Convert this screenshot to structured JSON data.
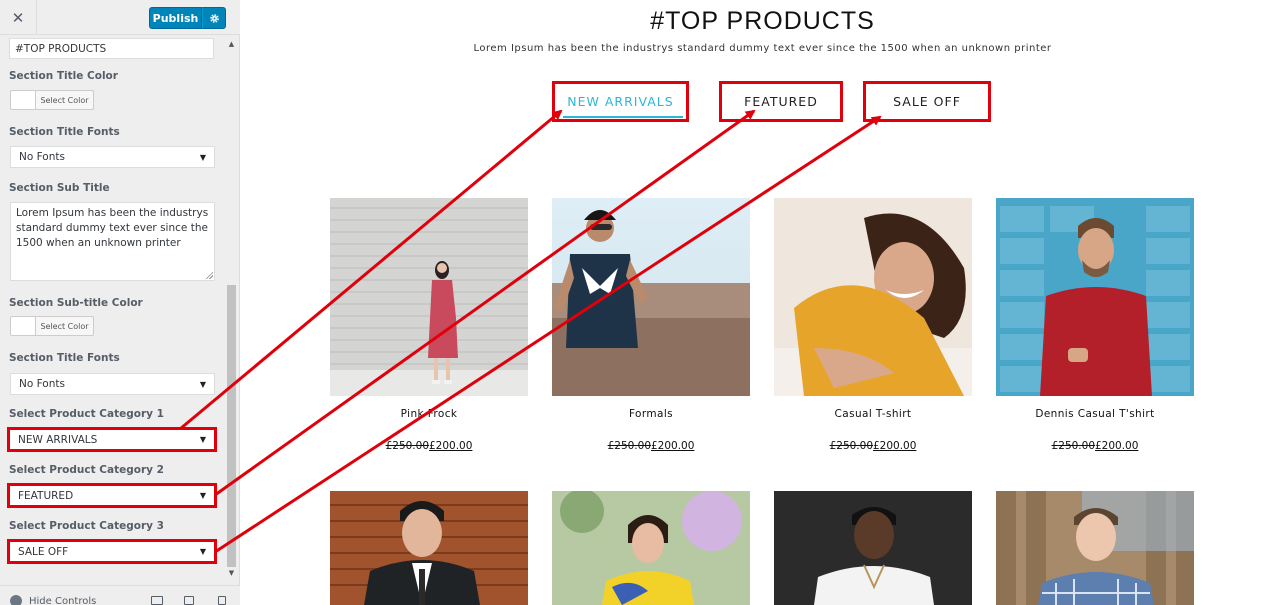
{
  "customizer": {
    "close_label": "✕",
    "publish_label": "Publish",
    "section_title_value": "#TOP PRODUCTS",
    "fields": {
      "title_color_label": "Section Title Color",
      "title_color_button": "Select Color",
      "title_fonts_label": "Section Title Fonts",
      "title_fonts_value": "No Fonts",
      "sub_title_label": "Section Sub Title",
      "sub_title_value": "Lorem Ipsum has been the industrys standard dummy text ever since the 1500 when an unknown printer",
      "sub_title_color_label": "Section Sub-title Color",
      "sub_title_color_button": "Select Color",
      "sub_title_fonts_label": "Section Title Fonts",
      "sub_title_fonts_value": "No Fonts",
      "cat1_label": "Select Product Category 1",
      "cat1_value": "NEW ARRIVALS",
      "cat2_label": "Select Product Category 2",
      "cat2_value": "FEATURED",
      "cat3_label": "Select Product Category 3",
      "cat3_value": "SALE OFF"
    },
    "footer": {
      "hide_controls_label": "Hide Controls"
    }
  },
  "preview": {
    "title": "#TOP PRODUCTS",
    "subtitle": "Lorem Ipsum has been the industrys standard dummy text ever since the 1500 when an unknown printer",
    "tabs": [
      {
        "label": "NEW ARRIVALS",
        "active": true
      },
      {
        "label": "FEATURED",
        "active": false
      },
      {
        "label": "SALE OFF",
        "active": false
      }
    ],
    "products": [
      {
        "name": "Pink Frock",
        "old_price": "£250.00",
        "new_price": "£200.00"
      },
      {
        "name": "Formals",
        "old_price": "£250.00",
        "new_price": "£200.00"
      },
      {
        "name": "Casual T-shirt",
        "old_price": "£250.00",
        "new_price": "£200.00"
      },
      {
        "name": "Dennis Casual T'shirt",
        "old_price": "£250.00",
        "new_price": "£200.00"
      }
    ]
  },
  "colors": {
    "accent": "#0085ba",
    "annotation": "#e0000b",
    "active_tab": "#2fb6d6"
  }
}
